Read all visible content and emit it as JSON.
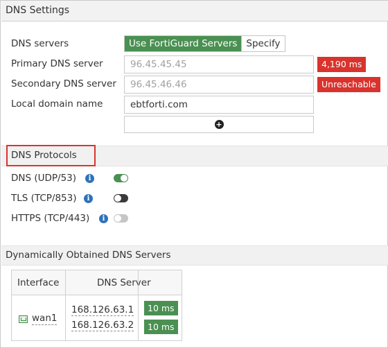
{
  "settings": {
    "header": "DNS Settings",
    "dns_servers_label": "DNS servers",
    "use_fortiguard_label": "Use FortiGuard Servers",
    "specify_label": "Specify",
    "primary_label": "Primary DNS server",
    "primary_value": "96.45.45.45",
    "primary_status": "4,190 ms",
    "secondary_label": "Secondary DNS server",
    "secondary_value": "96.45.46.46",
    "secondary_status": "Unreachable",
    "local_domain_label": "Local domain name",
    "local_domain_value": "ebtforti.com",
    "add_icon": "plus-circle-icon"
  },
  "protocols": {
    "header": "DNS Protocols",
    "items": [
      {
        "label": "DNS (UDP/53)",
        "state": "on"
      },
      {
        "label": "TLS (TCP/853)",
        "state": "off"
      },
      {
        "label": "HTTPS (TCP/443)",
        "state": "disabled"
      }
    ]
  },
  "dynamic": {
    "header": "Dynamically Obtained DNS Servers",
    "columns": [
      "Interface",
      "DNS Server"
    ],
    "rows": [
      {
        "interface": "wan1",
        "servers": [
          {
            "ip": "168.126.63.1",
            "latency": "10 ms"
          },
          {
            "ip": "168.126.63.2",
            "latency": "10 ms"
          }
        ]
      }
    ]
  },
  "colors": {
    "accent_green": "#4a9052",
    "alert_red": "#d9332d",
    "info_blue": "#2f72b8",
    "header_bg": "#f1f1f1"
  }
}
